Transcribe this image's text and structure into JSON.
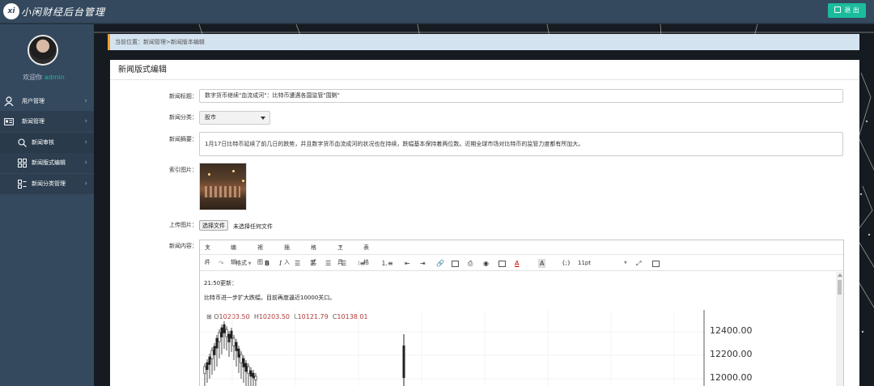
{
  "app": {
    "logo_badge": "xi",
    "title": "小闲财经后台管理",
    "logout_label": "退 出"
  },
  "user": {
    "welcome": "欢迎你",
    "name": "admin"
  },
  "sidebar": {
    "items": [
      {
        "label": "用户管理"
      },
      {
        "label": "新闻管理"
      },
      {
        "label": "新闻审核"
      },
      {
        "label": "新闻版式编辑"
      },
      {
        "label": "新闻分类管理"
      }
    ]
  },
  "breadcrumb": "当前位置：新闻管理>新闻版本编辑",
  "panel": {
    "title": "新闻版式编辑"
  },
  "form": {
    "title_label": "新闻标题：",
    "title_value": "数字货币继续\"血流成河\"：比特币遭遇各国监管\"围剿\"",
    "category_label": "新闻分类：",
    "category_value": "股市",
    "summary_label": "新闻摘要：",
    "summary_value": "1月17日比特币延续了前几日的跌势，并且数字货币血流成河的状况也在持续，跌幅基本保持着两位数。近期全球市场对比特币的监管力度都有所加大。",
    "image_label": "索引图片：",
    "upload_label": "上传图片：",
    "upload_button": "选择文件",
    "upload_status": "未选择任何文件",
    "content_label": "新闻内容："
  },
  "editor": {
    "menus": [
      "文件",
      "编辑",
      "视图",
      "插入",
      "格式",
      "工具",
      "表格"
    ],
    "format_label": "格式",
    "font_size": "11pt",
    "content_line1": "21:50更新：",
    "content_line2": "比特币进一步扩大跌幅，目前再度逼近10000关口。"
  },
  "chart_data": {
    "type": "candlestick",
    "ohlc_prefix": "⊞",
    "open_label": "O",
    "open": "10203.50",
    "high_label": "H",
    "high": "10203.50",
    "low_label": "L",
    "low": "10121.79",
    "close_label": "C",
    "close": "10138.01",
    "y_tick_labels": [
      "12400.00",
      "12200.00",
      "12000.00"
    ],
    "y_ticks": [
      12400,
      12200,
      12000
    ]
  },
  "colors": {
    "sidebar": "#34495e",
    "accent": "#1abc9c",
    "breadcrumb_bg": "#d4e3f0",
    "breadcrumb_border": "#f0a030",
    "ohlc_text": "#b23b3b"
  }
}
